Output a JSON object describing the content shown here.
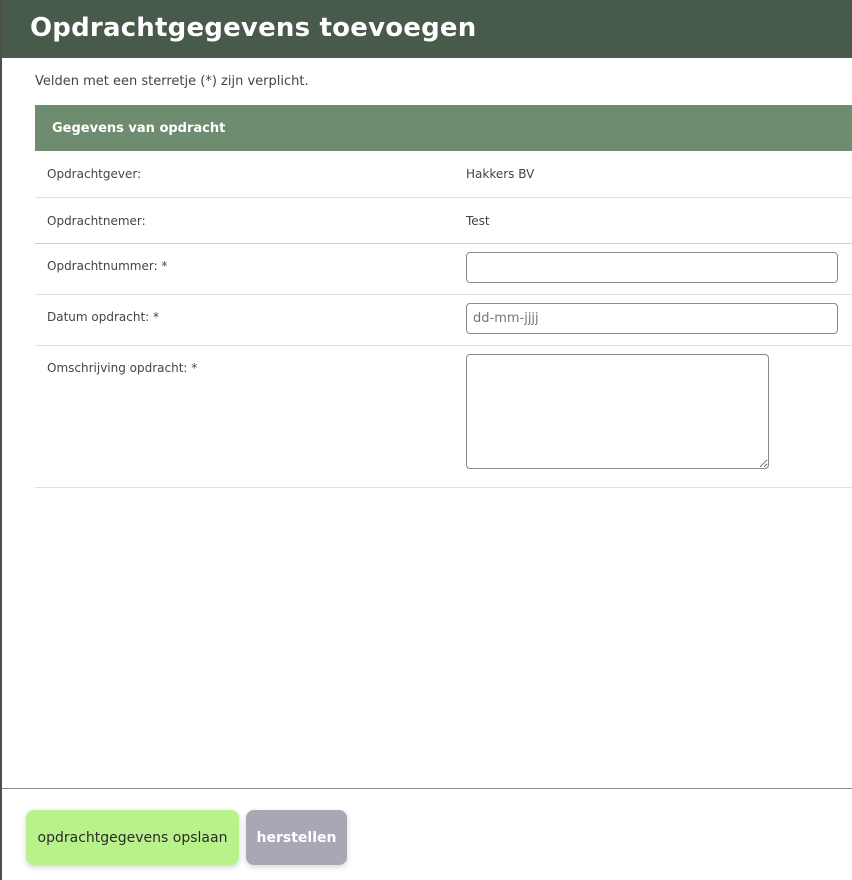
{
  "modal": {
    "title": "Opdrachtgegevens toevoegen",
    "required_note": "Velden met een sterretje (*) zijn verplicht."
  },
  "section": {
    "title": "Gegevens van opdracht",
    "rows": {
      "opdrachtgever": {
        "label": "Opdrachtgever:",
        "value": "Hakkers BV"
      },
      "opdrachtnemer": {
        "label": "Opdrachtnemer:",
        "value": "Test"
      },
      "opdrachtnummer": {
        "label": "Opdrachtnummer: *",
        "value": "",
        "placeholder": ""
      },
      "datum": {
        "label": "Datum opdracht: *",
        "value": "",
        "placeholder": "dd-mm-jjjj"
      },
      "omschrijving": {
        "label": "Omschrijving opdracht: *",
        "value": ""
      }
    }
  },
  "footer": {
    "save_label": "opdrachtgegevens opslaan",
    "reset_label": "herstellen"
  },
  "colors": {
    "header_bg": "#485a4a",
    "section_header_bg": "#6e8c6f",
    "save_button_bg": "#b9f28a",
    "reset_button_bg": "#a8a8b4"
  }
}
